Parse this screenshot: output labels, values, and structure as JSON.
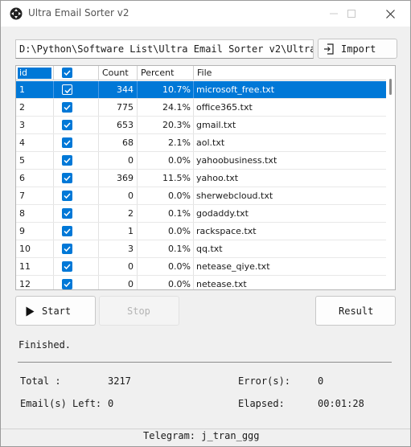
{
  "window": {
    "title": "Ultra Email Sorter v2",
    "icons": {
      "app": "move-arrows-icon",
      "minimize": "minimize-icon",
      "maximize": "maximize-icon",
      "close": "close-icon"
    }
  },
  "path": {
    "value": "D:\\Python\\Software List\\Ultra Email Sorter v2\\Ultra"
  },
  "import_button": {
    "label": "Import",
    "icon": "import-icon"
  },
  "table": {
    "columns": [
      "id",
      "",
      "Count",
      "Percent",
      "File"
    ],
    "header_checkbox_checked": true,
    "selected_row": 0,
    "rows": [
      {
        "id": "1",
        "checked": true,
        "count": "344",
        "percent": "10.7%",
        "file": "microsoft_free.txt"
      },
      {
        "id": "2",
        "checked": true,
        "count": "775",
        "percent": "24.1%",
        "file": "office365.txt"
      },
      {
        "id": "3",
        "checked": true,
        "count": "653",
        "percent": "20.3%",
        "file": "gmail.txt"
      },
      {
        "id": "4",
        "checked": true,
        "count": "68",
        "percent": "2.1%",
        "file": "aol.txt"
      },
      {
        "id": "5",
        "checked": true,
        "count": "0",
        "percent": "0.0%",
        "file": "yahoobusiness.txt"
      },
      {
        "id": "6",
        "checked": true,
        "count": "369",
        "percent": "11.5%",
        "file": "yahoo.txt"
      },
      {
        "id": "7",
        "checked": true,
        "count": "0",
        "percent": "0.0%",
        "file": "sherwebcloud.txt"
      },
      {
        "id": "8",
        "checked": true,
        "count": "2",
        "percent": "0.1%",
        "file": "godaddy.txt"
      },
      {
        "id": "9",
        "checked": true,
        "count": "1",
        "percent": "0.0%",
        "file": "rackspace.txt"
      },
      {
        "id": "10",
        "checked": true,
        "count": "3",
        "percent": "0.1%",
        "file": "qq.txt"
      },
      {
        "id": "11",
        "checked": true,
        "count": "0",
        "percent": "0.0%",
        "file": "netease_qiye.txt"
      },
      {
        "id": "12",
        "checked": true,
        "count": "0",
        "percent": "0.0%",
        "file": "netease.txt"
      }
    ]
  },
  "buttons": {
    "start": "Start",
    "stop": "Stop",
    "result": "Result",
    "stop_enabled": false
  },
  "status": "Finished.",
  "stats": {
    "total_label": "Total :",
    "total_value": "3217",
    "errors_label": "Error(s):",
    "errors_value": "0",
    "left_label": "Email(s) Left:",
    "left_value": "0",
    "elapsed_label": "Elapsed:",
    "elapsed_value": "00:01:28"
  },
  "footer": "Telegram: j_tran_ggg",
  "colors": {
    "accent": "#0078d7",
    "window_bg": "#f0f0f0",
    "disabled_text": "#b4b4b4"
  }
}
